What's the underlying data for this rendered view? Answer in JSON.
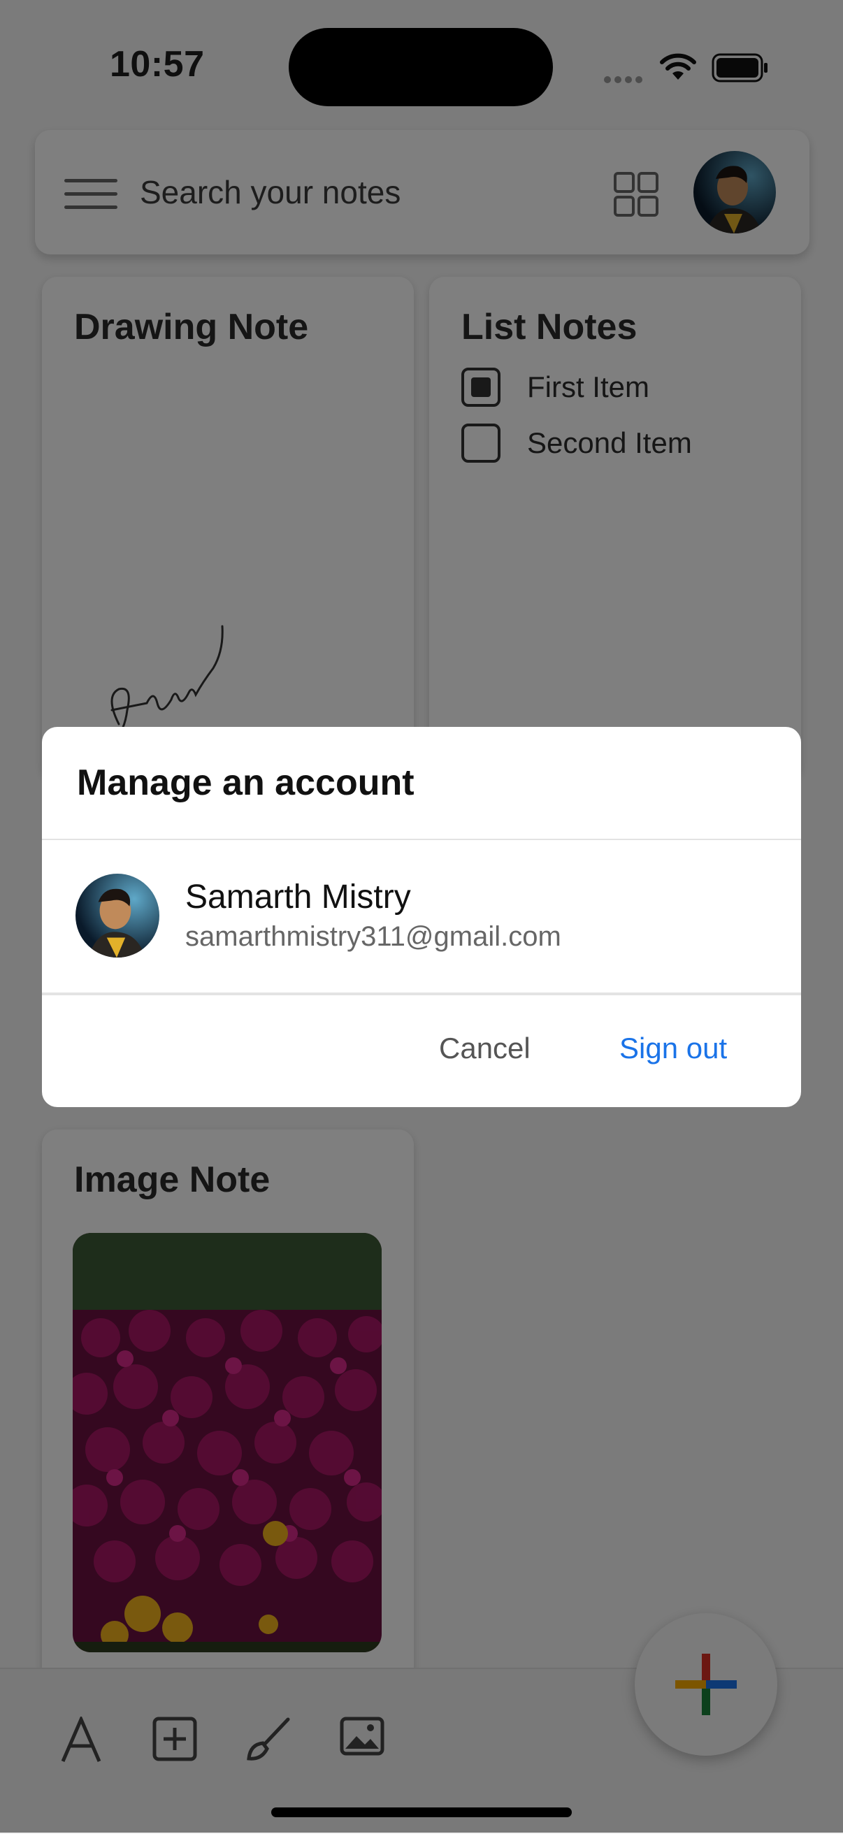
{
  "status_bar": {
    "time": "10:57"
  },
  "search_bar": {
    "placeholder": "Search your notes",
    "icons": [
      "menu-icon",
      "grid-view-icon",
      "avatar"
    ]
  },
  "notes": [
    {
      "title": "Drawing Note",
      "type": "drawing"
    },
    {
      "title": "List Notes",
      "type": "list",
      "items": [
        {
          "label": "First Item",
          "checked": true
        },
        {
          "label": "Second Item",
          "checked": false
        }
      ]
    },
    {
      "title": "Image Note",
      "type": "image"
    }
  ],
  "toolbar": {
    "icons": [
      "text-icon",
      "add-box-icon",
      "brush-icon",
      "image-icon"
    ],
    "fab_icon": "plus-icon"
  },
  "dialog": {
    "title": "Manage an account",
    "account": {
      "name": "Samarth Mistry",
      "email": "samarthmistry311@gmail.com"
    },
    "cancel_label": "Cancel",
    "signout_label": "Sign out"
  },
  "colors": {
    "accent": "#1a73e8",
    "plus_red": "#d93025",
    "plus_blue": "#1a73e8",
    "plus_green": "#188038",
    "plus_yellow": "#f9ab00"
  }
}
